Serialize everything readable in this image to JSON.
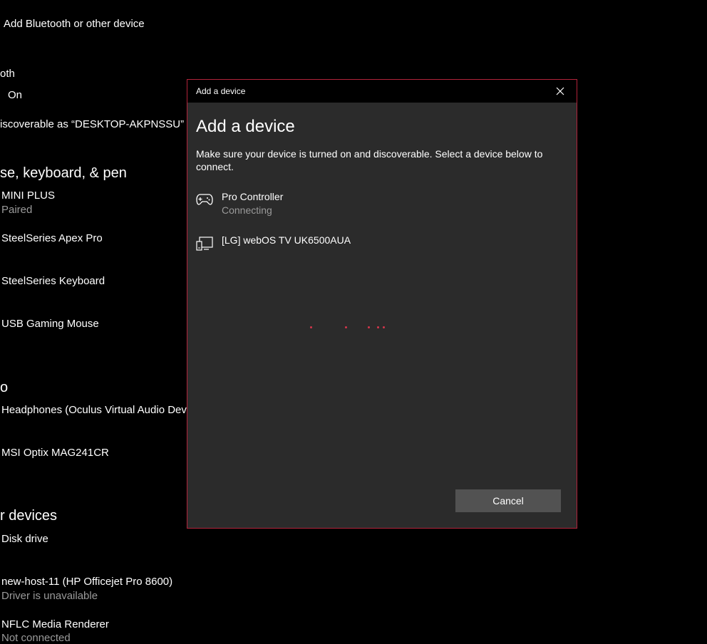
{
  "background": {
    "title": "Add Bluetooth or other device",
    "bluetooth_label": "oth",
    "bluetooth_state": "On",
    "discoverable": "iscoverable as “DESKTOP-AKPNSSU”",
    "section_mouse": "se, keyboard, & pen",
    "mouse_devices": [
      {
        "name": "MINI PLUS",
        "status": "Paired"
      },
      {
        "name": "SteelSeries Apex Pro"
      },
      {
        "name": "SteelSeries Keyboard"
      },
      {
        "name": "USB Gaming Mouse"
      }
    ],
    "section_audio": "o",
    "audio_devices": [
      {
        "name": "Headphones (Oculus Virtual Audio Devi"
      },
      {
        "name": "MSI Optix MAG241CR"
      }
    ],
    "section_other": "r devices",
    "other_devices": [
      {
        "name": "Disk drive"
      },
      {
        "name": "new-host-11 (HP Officejet Pro 8600)",
        "status": "Driver is unavailable"
      },
      {
        "name": "NFLC Media Renderer",
        "status": "Not connected"
      }
    ]
  },
  "dialog": {
    "window_title": "Add a device",
    "heading": "Add a device",
    "description": "Make sure your device is turned on and discoverable. Select a device below to connect.",
    "devices": [
      {
        "name": "Pro Controller",
        "status": "Connecting",
        "icon": "gamepad-icon"
      },
      {
        "name": "[LG] webOS TV UK6500AUA",
        "icon": "display-icon"
      }
    ],
    "cancel_label": "Cancel",
    "accent_color": "#b2233a"
  }
}
